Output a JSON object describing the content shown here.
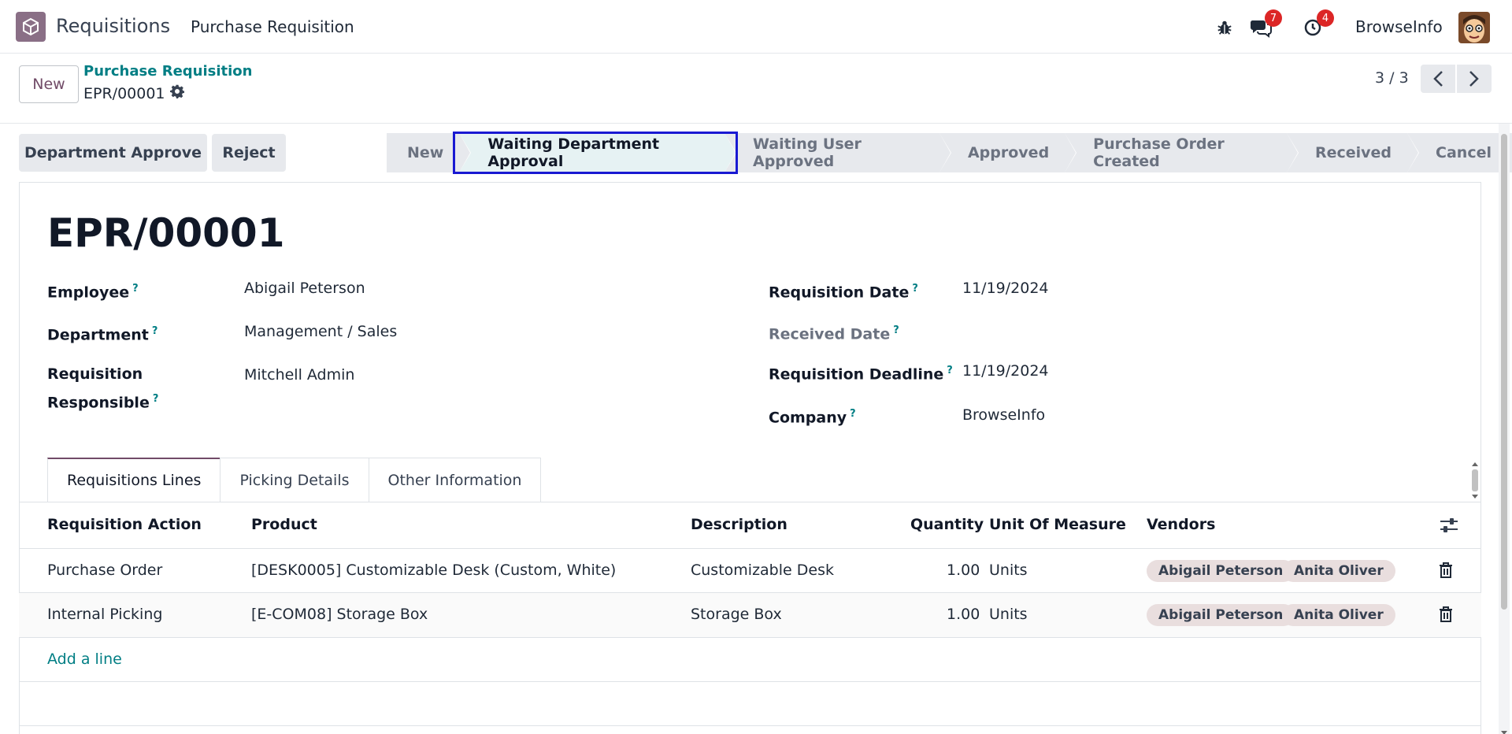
{
  "navbar": {
    "app_name": "Requisitions",
    "menu_item": "Purchase Requisition",
    "messages_count": "7",
    "activities_count": "4",
    "company": "BrowseInfo"
  },
  "control_panel": {
    "new_label": "New",
    "breadcrumb": "Purchase Requisition",
    "record_name": "EPR/00001",
    "pager": "3 / 3"
  },
  "actions": {
    "approve": "Department Approve",
    "reject": "Reject"
  },
  "stages": [
    {
      "label": "New"
    },
    {
      "label": "Waiting Department Approval"
    },
    {
      "label": "Waiting User Approved"
    },
    {
      "label": "Approved"
    },
    {
      "label": "Purchase Order Created"
    },
    {
      "label": "Received"
    },
    {
      "label": "Cancel"
    }
  ],
  "form": {
    "title": "EPR/00001",
    "employee_label": "Employee",
    "employee": "Abigail Peterson",
    "department_label": "Department",
    "department": "Management / Sales",
    "responsible_label_1": "Requisition",
    "responsible_label_2": "Responsible",
    "responsible": "Mitchell Admin",
    "req_date_label": "Requisition Date",
    "req_date": "11/19/2024",
    "received_date_label": "Received Date",
    "deadline_label": "Requisition Deadline",
    "deadline": "11/19/2024",
    "company_label": "Company",
    "company": "BrowseInfo",
    "help_mark": "?"
  },
  "tabs": [
    "Requisitions Lines",
    "Picking Details",
    "Other Information"
  ],
  "table": {
    "headers": {
      "action": "Requisition Action",
      "product": "Product",
      "description": "Description",
      "quantity": "Quantity",
      "uom": "Unit Of Measure",
      "vendors": "Vendors"
    },
    "rows": [
      {
        "action": "Purchase Order",
        "product": "[DESK0005] Customizable Desk (Custom, White)",
        "description": "Customizable Desk",
        "quantity": "1.00",
        "uom": "Units",
        "vendors": [
          "Abigail Peterson",
          "Anita Oliver"
        ]
      },
      {
        "action": "Internal Picking",
        "product": "[E-COM08] Storage Box",
        "description": "Storage Box",
        "quantity": "1.00",
        "uom": "Units",
        "vendors": [
          "Abigail Peterson",
          "Anita Oliver"
        ]
      }
    ],
    "add_line": "Add a line"
  },
  "colors": {
    "brand": "#714b67",
    "link": "#017e84",
    "highlight": "#1919d2",
    "badge": "#dc2626"
  }
}
